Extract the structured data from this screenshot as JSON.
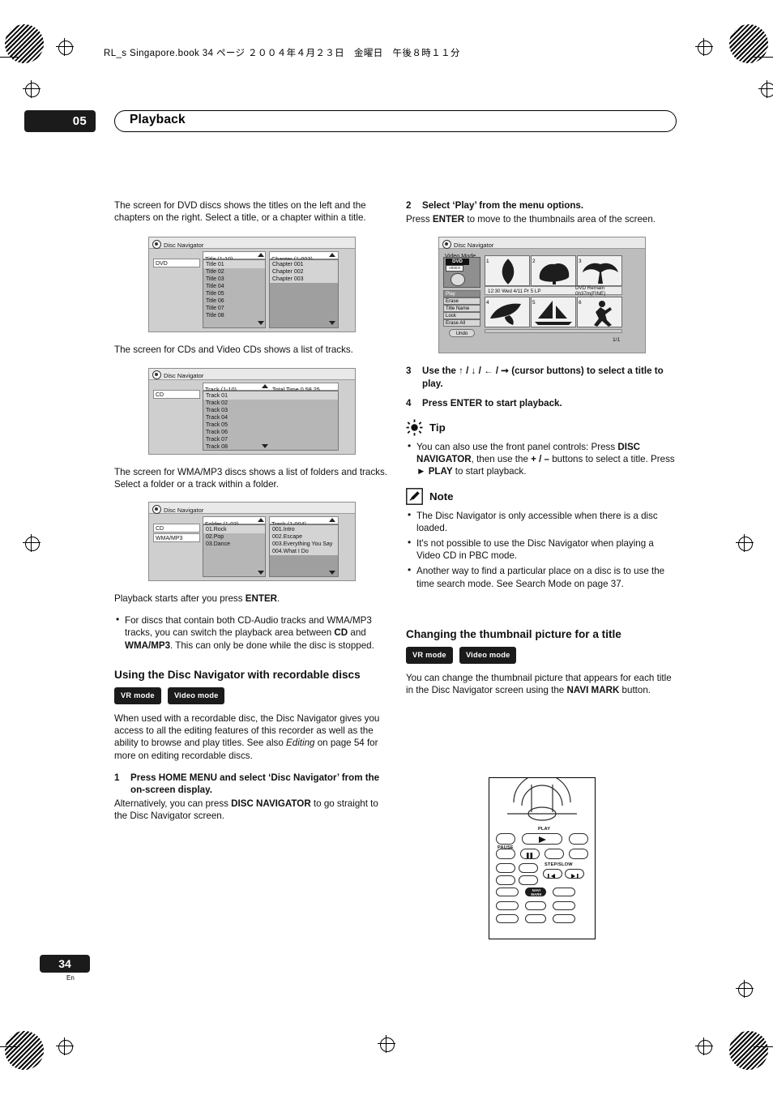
{
  "header": {
    "book_line": "RL_s Singapore.book 34 ページ ２００４年４月２３日　金曜日　午後８時１１分"
  },
  "chapter": {
    "number": "05",
    "title": "Playback"
  },
  "page": {
    "number": "34",
    "lang": "En"
  },
  "left_column": {
    "intro": "The screen for DVD discs shows the titles on the left and the chapters on the right. Select a title, or a chapter within a title.",
    "cd_text": "The screen for CDs and Video CDs shows a list of tracks.",
    "wma_text": "The screen for WMA/MP3 discs shows a list of folders and tracks. Select a folder or a track within a folder.",
    "playback_starts": "Playback starts after you press ",
    "playback_starts_bold": "ENTER",
    "playback_starts_end": ".",
    "bullet_1": {
      "a": "For discs that contain both CD-Audio tracks and WMA/MP3 tracks, you can switch the playback area between ",
      "b1": "CD",
      "mid": " and ",
      "b2": "WMA/MP3",
      "c": ". This can only be done while the disc is stopped."
    },
    "heading": "Using the Disc Navigator with recordable discs",
    "badges": [
      "VR mode",
      "Video mode"
    ],
    "body": "When used with a recordable disc, the Disc Navigator gives you access to all the editing features of this recorder as well as the ability to browse and play titles. See also ",
    "body_italic": "Editing",
    "body_end": " on page 54 for more on editing recordable discs.",
    "step1_num": "1",
    "step1_head": "Press HOME MENU and select ‘Disc Navigator’ from the on-screen display.",
    "step1_body_a": "Alternatively, you can press ",
    "step1_body_b": "DISC NAVIGATOR",
    "step1_body_c": " to go straight to the Disc Navigator screen."
  },
  "right_column": {
    "step2_num": "2",
    "step2_head": "Select ‘Play’ from the menu options.",
    "step2_body_a": "Press ",
    "step2_body_b": "ENTER",
    "step2_body_c": " to move to the thumbnails area of the screen.",
    "step3_num": "3",
    "step3_head_a": "Use the ",
    "step3_arrows": "↑ / ↓ / ← / ➞",
    "step3_head_b": " (cursor buttons) to select a title to play.",
    "step4_num": "4",
    "step4_head": "Press ENTER to start playback.",
    "tip_label": "Tip",
    "tip_bullet_a": "You can also use the front panel controls: Press ",
    "tip_bullet_b": "DISC NAVIGATOR",
    "tip_bullet_c": ", then use the ",
    "tip_bullet_d": "+ / –",
    "tip_bullet_e": " buttons to select a title. Press ",
    "tip_bullet_f": "► PLAY",
    "tip_bullet_g": " to start playback.",
    "note_label": "Note",
    "notes": [
      "The Disc Navigator is only accessible when there is a disc loaded.",
      "It's not possible to use the Disc Navigator when playing a Video CD in PBC mode.",
      "Another way to find a particular place on a disc is to use the time search mode. See Search Mode on page 37."
    ],
    "note3_italic": "Search Mode",
    "heading2": "Changing the thumbnail picture for a title",
    "badges": [
      "VR mode",
      "Video mode"
    ],
    "body2_a": "You can change the thumbnail picture that appears for each title in the Disc Navigator screen using the ",
    "body2_b": "NAVI MARK",
    "body2_c": " button."
  },
  "fig_dvd": {
    "window_title": "Disc Navigator",
    "disc_label": "DVD",
    "col1_header": "Title (1-10)",
    "col2_header": "Chapter (1-003)",
    "titles": [
      "Title 01",
      "Title 02",
      "Title 03",
      "Title 04",
      "Title 05",
      "Title 06",
      "Title 07",
      "Title 08"
    ],
    "chapters": [
      "Chapter 001",
      "Chapter 002",
      "Chapter 003"
    ]
  },
  "fig_cd": {
    "window_title": "Disc Navigator",
    "disc_label": "CD",
    "col1_header": "Track (1-10)",
    "total_time": "Total Time 0.58.25",
    "tracks": [
      "Track 01",
      "Track 02",
      "Track 03",
      "Track 04",
      "Track 05",
      "Track 06",
      "Track 07",
      "Track 08"
    ]
  },
  "fig_wma": {
    "window_title": "Disc Navigator",
    "disc_label_1": "CD",
    "disc_label_2": "WMA/MP3",
    "col1_header": "Folder (1-03)",
    "col2_header": "Track (1-004)",
    "folders": [
      "01.Rock",
      "02.Pop",
      "03.Dance"
    ],
    "tracks": [
      "001.Intro",
      "002.Escape",
      "003.Everything You Say",
      "004.What I Do"
    ]
  },
  "fig_video": {
    "window_title": "Disc Navigator",
    "mode_label": "Video Mode",
    "disc_badge": "DVD",
    "disc_sub": "VIDEO",
    "info_line": "12:30 Wed  4/11  Pr 5   LP",
    "remain_line": "DVD Remain",
    "remain_time": "0h37m(FINE)",
    "menu_items": [
      "Play",
      "Erase",
      "Title Name",
      "Lock",
      "Erase All",
      "Undo"
    ],
    "page_indicator": "1/1",
    "thumb_numbers": [
      "1",
      "2",
      "3",
      "4",
      "5",
      "6"
    ]
  },
  "remote": {
    "play_label": "PLAY",
    "pause_label": "PAUSE",
    "step_slow_label": "STEP/SLOW",
    "navi_mark_label": "NAVI MARK"
  }
}
